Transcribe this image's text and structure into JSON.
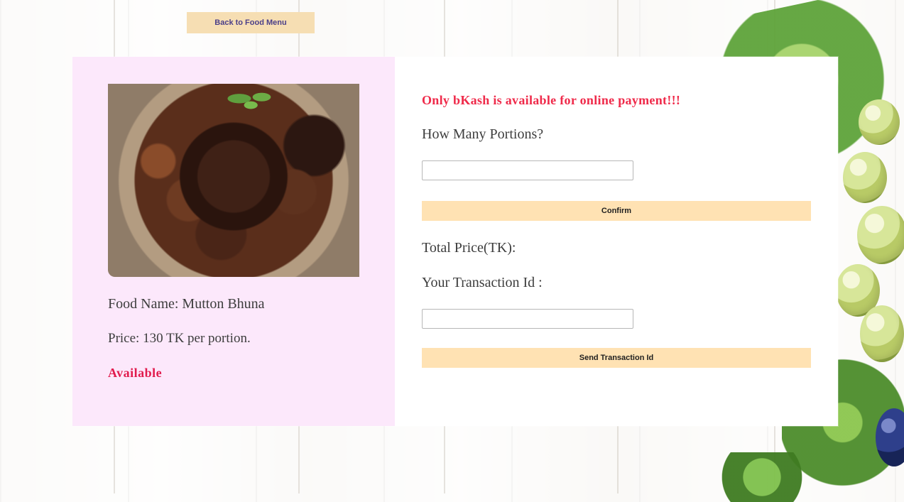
{
  "page": {
    "back_button_label": "Back to Food Menu"
  },
  "food": {
    "name": "Food Name: Mutton Bhuna",
    "price": "Price: 130 TK per portion.",
    "status": "Available"
  },
  "order": {
    "notice": "Only bKash is available for online payment!!!",
    "portions_label": "How Many Portions?",
    "portions_value": "",
    "confirm_label": "Confirm",
    "total_price_label": "Total Price(TK):",
    "transaction_label": "Your Transaction Id :",
    "transaction_value": "",
    "send_label": "Send Transaction Id"
  },
  "icons": {
    "food_image": "food-image"
  },
  "colors": {
    "left_panel": "#fce8fb",
    "accent_button": "#ffe2b3",
    "notice_text": "#ef2a4a",
    "status_text": "#e11b4d"
  }
}
